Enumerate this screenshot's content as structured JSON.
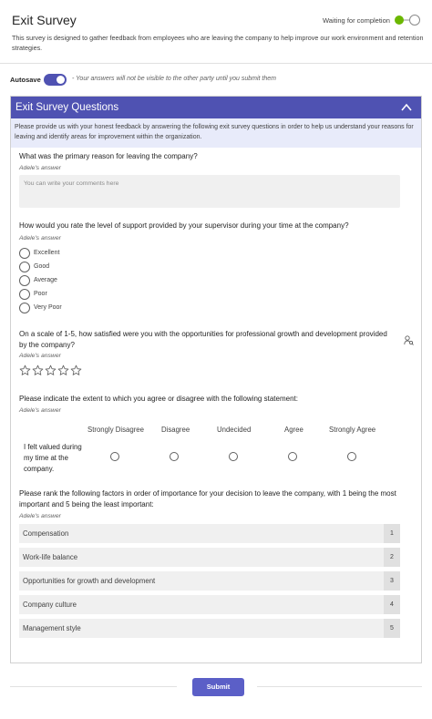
{
  "header": {
    "title": "Exit Survey",
    "description": "This survey is designed to gather feedback from employees who are leaving the company to help improve our work environment and retention strategies.",
    "status": "Waiting for completion"
  },
  "autosave": {
    "label": "Autosave",
    "enabled": true,
    "note": "- Your answers will not be visible to the other party until you submit them"
  },
  "section": {
    "title": "Exit Survey Questions",
    "info": "Please provide us with your honest feedback by answering the following exit survey questions in order to help us understand your reasons for leaving and identify areas for improvement within the organization.",
    "questions": {
      "q1": {
        "text": "What was the primary reason for leaving the company?",
        "answer_by": "Adele's answer",
        "placeholder": "You can write your comments here"
      },
      "q2": {
        "text": "How would you rate the level of support provided by your supervisor during your time at the company?",
        "answer_by": "Adele's answer",
        "options": [
          "Excellent",
          "Good",
          "Average",
          "Poor",
          "Very Poor"
        ]
      },
      "q3": {
        "text": "On a scale of 1-5, how satisfied were you with the opportunities for professional growth and development provided by the company?",
        "answer_by": "Adele's answer",
        "stars": 5,
        "rating": 0
      },
      "q4": {
        "text": "Please indicate the extent to which you agree or disagree with the following statement:",
        "answer_by": "Adele's answer",
        "columns": [
          "Strongly Disagree",
          "Disagree",
          "Undecided",
          "Agree",
          "Strongly Agree"
        ],
        "statement": "I felt valued during my time at the company."
      },
      "q5": {
        "text": "Please rank the following factors in order of importance for your decision to leave the company, with 1 being the most important and 5 being the least important:",
        "answer_by": "Adele's answer",
        "items": [
          {
            "label": "Compensation",
            "rank": "1"
          },
          {
            "label": "Work-life balance",
            "rank": "2"
          },
          {
            "label": "Opportunities for growth and development",
            "rank": "3"
          },
          {
            "label": "Company culture",
            "rank": "4"
          },
          {
            "label": "Management style",
            "rank": "5"
          }
        ]
      }
    }
  },
  "footer": {
    "submit_label": "Submit"
  },
  "colors": {
    "accent": "#4f52b2",
    "submit": "#5b5fc7",
    "status_green": "#6bb700",
    "info_bg": "#e8ebfa"
  },
  "icons": {
    "collapse": "chevron-up-icon",
    "assignee": "person-search-icon",
    "rating": "star-outline-icon"
  }
}
